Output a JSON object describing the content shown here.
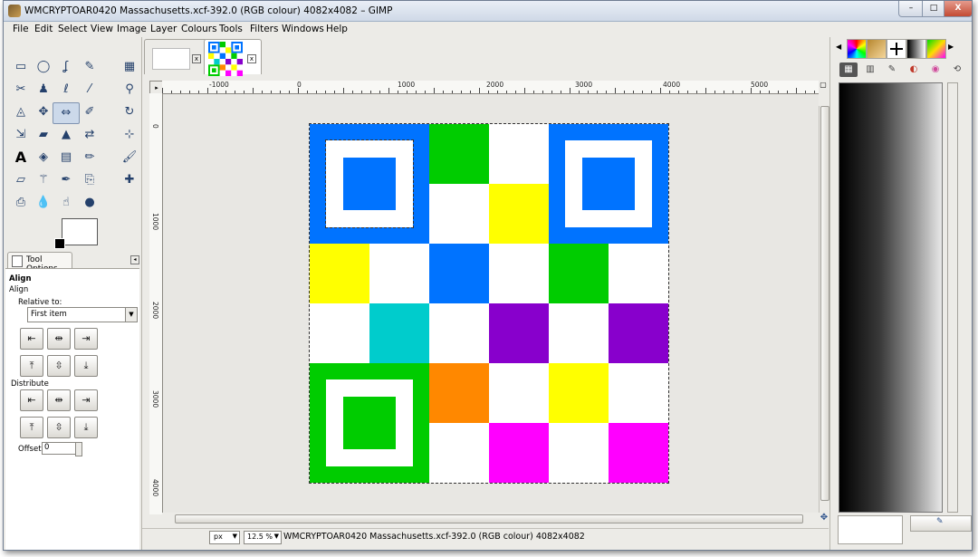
{
  "window": {
    "title": "WMCRYPTOAR0420 Massachusetts.xcf-392.0 (RGB colour) 4082x4082 – GIMP",
    "controls": {
      "minimize": "–",
      "maximize": "□",
      "close": "X"
    }
  },
  "menu": [
    "File",
    "Edit",
    "Select",
    "View",
    "Image",
    "Layer",
    "Colours",
    "Tools",
    "Filters",
    "Windows",
    "Help"
  ],
  "toolbox": {
    "tools": [
      {
        "name": "rect-select-icon",
        "glyph": "▭"
      },
      {
        "name": "ellipse-select-icon",
        "glyph": "◯"
      },
      {
        "name": "free-select-icon",
        "glyph": "ʆ"
      },
      {
        "name": "fuzzy-select-icon",
        "glyph": "✎"
      },
      {
        "name": "select-by-color-icon",
        "glyph": "▦"
      },
      {
        "name": "scissors-select-icon",
        "glyph": "✂"
      },
      {
        "name": "foreground-select-icon",
        "glyph": "♟"
      },
      {
        "name": "paths-icon",
        "glyph": "ℓ"
      },
      {
        "name": "color-picker-icon",
        "glyph": "⁄"
      },
      {
        "name": "zoom-icon",
        "glyph": "⚲"
      },
      {
        "name": "measure-icon",
        "glyph": "◬"
      },
      {
        "name": "move-icon",
        "glyph": "✥"
      },
      {
        "name": "align-icon",
        "glyph": "⇔"
      },
      {
        "name": "crop-icon",
        "glyph": "✐"
      },
      {
        "name": "rotate-icon",
        "glyph": "↻"
      },
      {
        "name": "scale-icon",
        "glyph": "⇲"
      },
      {
        "name": "shear-icon",
        "glyph": "▰"
      },
      {
        "name": "perspective-icon",
        "glyph": "▲"
      },
      {
        "name": "flip-icon",
        "glyph": "⇄"
      },
      {
        "name": "cage-transform-icon",
        "glyph": "⊹"
      },
      {
        "name": "text-icon",
        "glyph": "A"
      },
      {
        "name": "bucket-fill-icon",
        "glyph": "◈"
      },
      {
        "name": "blend-icon",
        "glyph": "▤"
      },
      {
        "name": "pencil-icon",
        "glyph": "✏"
      },
      {
        "name": "paintbrush-icon",
        "glyph": "🖌"
      },
      {
        "name": "eraser-icon",
        "glyph": "▱"
      },
      {
        "name": "airbrush-icon",
        "glyph": "⚚"
      },
      {
        "name": "ink-icon",
        "glyph": "✒"
      },
      {
        "name": "clone-icon",
        "glyph": "⎘"
      },
      {
        "name": "heal-icon",
        "glyph": "✚"
      },
      {
        "name": "perspective-clone-icon",
        "glyph": "⎙"
      },
      {
        "name": "blur-icon",
        "glyph": "💧"
      },
      {
        "name": "smudge-icon",
        "glyph": "☝"
      },
      {
        "name": "dodge-burn-icon",
        "glyph": "●"
      }
    ]
  },
  "tool_options": {
    "tab_label": "Tool Options",
    "heading": "Align",
    "subheading": "Align",
    "relative_to_label": "Relative to:",
    "relative_to_value": "First item",
    "distribute_label": "Distribute",
    "offset_label": "Offset:",
    "offset_value": "0",
    "align_buttons": [
      "⇤",
      "⇹",
      "⇥",
      "⤒",
      "⇳",
      "⤓"
    ]
  },
  "ruler": {
    "h_labels": [
      "-1000",
      "0",
      "1000",
      "2000",
      "3000",
      "4000",
      "5000"
    ],
    "v_labels": [
      "0",
      "1000",
      "2000",
      "3000",
      "4000"
    ]
  },
  "image": {
    "grid_size": 6,
    "colors": {
      "blue": "#0073ff",
      "green": "#00cc00",
      "yellow": "#ffff00",
      "cyan": "#00cccc",
      "purple": "#8800cc",
      "orange": "#ff8800",
      "magenta": "#ff00ff",
      "white": "#ffffff"
    },
    "cells": [
      [
        "blue-finder",
        "",
        "green",
        "white",
        "blue-finder",
        ""
      ],
      [
        "",
        "",
        "white",
        "yellow",
        "",
        ""
      ],
      [
        "yellow",
        "white",
        "blue",
        "white",
        "green",
        "white"
      ],
      [
        "white",
        "cyan",
        "white",
        "purple",
        "white",
        "purple"
      ],
      [
        "green-finder",
        "",
        "orange",
        "white",
        "yellow",
        "white"
      ],
      [
        "",
        "",
        "white",
        "magenta",
        "white",
        "magenta"
      ]
    ]
  },
  "status": {
    "unit": "px",
    "zoom": "12.5 %",
    "text": "WMCRYPTOAR0420 Massachusetts.xcf-392.0 (RGB colour) 4082x4082"
  }
}
